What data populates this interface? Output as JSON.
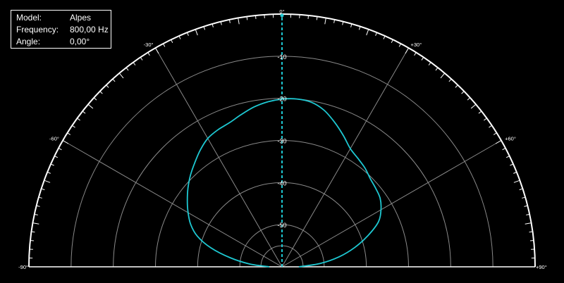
{
  "info": {
    "model_label": "Model:",
    "model_value": "Alpes",
    "frequency_label": "Frequency:",
    "frequency_value": "800,00 Hz",
    "angle_label": "Angle:",
    "angle_value": "0,00°"
  },
  "chart_data": {
    "type": "polar-half",
    "title": "",
    "angle_range_deg": [
      -90,
      90
    ],
    "angle_ticks": [
      {
        "deg": -90,
        "label": "-90°"
      },
      {
        "deg": -60,
        "label": "-60°"
      },
      {
        "deg": -30,
        "label": "-30°"
      },
      {
        "deg": 0,
        "label": "0°"
      },
      {
        "deg": 30,
        "label": "+30°"
      },
      {
        "deg": 60,
        "label": "+60°"
      },
      {
        "deg": 90,
        "label": "+90°"
      }
    ],
    "radial_ticks": [
      -10,
      -20,
      -30,
      -40,
      -50
    ],
    "radial_range_db": [
      -60,
      0
    ],
    "grid": true,
    "series": [
      {
        "color": "#1ec8d2",
        "points": [
          {
            "angle": -90,
            "db": -57.0
          },
          {
            "angle": -85,
            "db": -52.3
          },
          {
            "angle": -80,
            "db": -47.5
          },
          {
            "angle": -75,
            "db": -42.5
          },
          {
            "angle": -70,
            "db": -38.6
          },
          {
            "angle": -65,
            "db": -36.1
          },
          {
            "angle": -60,
            "db": -34.3
          },
          {
            "angle": -55,
            "db": -32.6
          },
          {
            "angle": -50,
            "db": -30.9
          },
          {
            "angle": -45,
            "db": -29.3
          },
          {
            "angle": -40,
            "db": -27.8
          },
          {
            "angle": -35,
            "db": -26.2
          },
          {
            "angle": -30,
            "db": -24.8
          },
          {
            "angle": -25,
            "db": -24.1
          },
          {
            "angle": -20,
            "db": -23.6
          },
          {
            "angle": -15,
            "db": -22.6
          },
          {
            "angle": -10,
            "db": -21.5
          },
          {
            "angle": -5,
            "db": -20.7
          },
          {
            "angle": 0,
            "db": -20.2
          },
          {
            "angle": 5,
            "db": -20.0
          },
          {
            "angle": 10,
            "db": -20.3
          },
          {
            "angle": 15,
            "db": -21.5
          },
          {
            "angle": 20,
            "db": -23.5
          },
          {
            "angle": 25,
            "db": -25.6
          },
          {
            "angle": 30,
            "db": -27.6
          },
          {
            "angle": 35,
            "db": -28.6
          },
          {
            "angle": 40,
            "db": -29.4
          },
          {
            "angle": 45,
            "db": -30.4
          },
          {
            "angle": 50,
            "db": -31.0
          },
          {
            "angle": 55,
            "db": -31.6
          },
          {
            "angle": 60,
            "db": -32.9
          },
          {
            "angle": 65,
            "db": -34.8
          },
          {
            "angle": 70,
            "db": -38.3
          },
          {
            "angle": 75,
            "db": -42.1
          },
          {
            "angle": 80,
            "db": -46.2
          },
          {
            "angle": 85,
            "db": -50.9
          },
          {
            "angle": 90,
            "db": -56.0
          }
        ]
      }
    ],
    "cursor_angle_deg": 0
  },
  "colors": {
    "background": "#000000",
    "outline": "#ffffff",
    "grid": "#8a8a8a",
    "curve": "#1ec8d2",
    "cursor": "#1ec8d2"
  }
}
